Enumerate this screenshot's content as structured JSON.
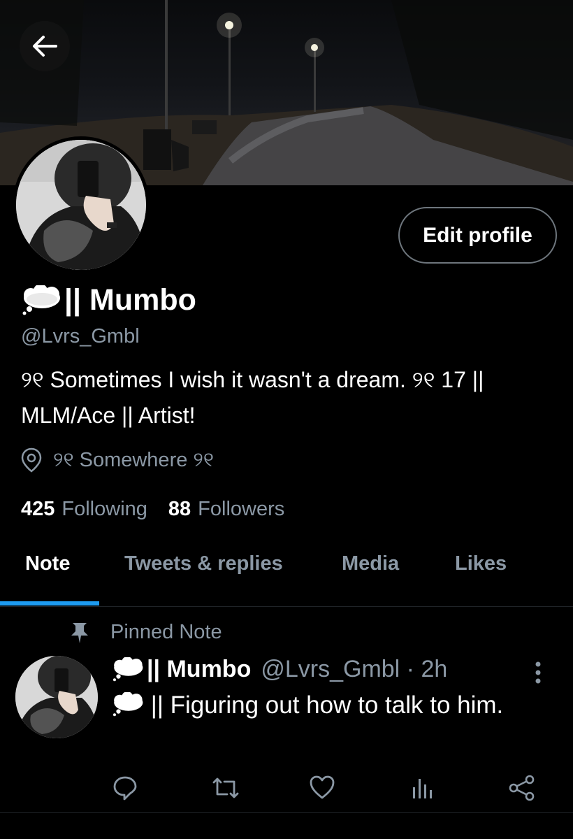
{
  "header": {
    "back_icon": "arrow-left-icon",
    "banner": "night park path with street lamps"
  },
  "profile": {
    "name_emoji": "thought-balloon",
    "display_name": "|| Mumbo",
    "handle": "@Lvrs_Gmbl",
    "bio": "୨୧ Sometimes I wish it wasn't a dream. ୨୧ 17 || MLM/Ace || Artist!",
    "location": "୨୧ Somewhere ୨୧",
    "following_count": "425",
    "following_label": "Following",
    "followers_count": "88",
    "followers_label": "Followers",
    "edit_label": "Edit profile"
  },
  "tabs": [
    {
      "label": "Note",
      "active": true
    },
    {
      "label": "Tweets & replies",
      "active": false
    },
    {
      "label": "Media",
      "active": false
    },
    {
      "label": "Likes",
      "active": false
    }
  ],
  "pinned": {
    "label": "Pinned Note",
    "tweet": {
      "display_name": "|| Mumbo",
      "handle": "@Lvrs_Gmbl · 2h",
      "text": " || Figuring out how to talk to him."
    }
  },
  "colors": {
    "accent": "#1d9bf0",
    "background": "#000000",
    "muted_text": "#8b98a5"
  }
}
